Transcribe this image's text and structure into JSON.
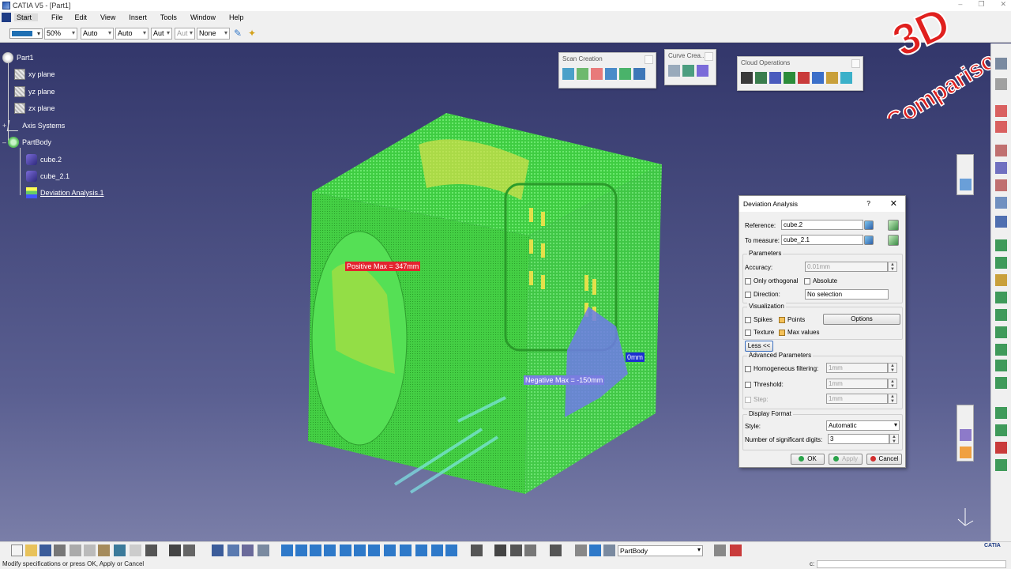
{
  "window": {
    "title": "CATIA V5 - [Part1]"
  },
  "menu": [
    "Start",
    "File",
    "Edit",
    "View",
    "Insert",
    "Tools",
    "Window",
    "Help"
  ],
  "graphic_properties": {
    "color": "#1f6fb3",
    "transparency": "50%",
    "line_thickness": "Auto",
    "line_type": "Auto",
    "point_type": "Aut",
    "point_type2": "Aut",
    "layer": "None"
  },
  "tree": {
    "root": "Part1",
    "items": [
      {
        "label": "xy plane"
      },
      {
        "label": "yz plane"
      },
      {
        "label": "zx plane"
      },
      {
        "label": "Axis Systems"
      },
      {
        "label": "PartBody"
      },
      {
        "label": "cube.2"
      },
      {
        "label": "cube_2.1"
      },
      {
        "label": "Deviation Analysis.1"
      }
    ]
  },
  "toolbars": {
    "scan_creation": "Scan Creation",
    "curve_creation": "Curve Crea...",
    "cloud_operations": "Cloud Operations"
  },
  "labels": {
    "positive_max": "Positive Max = 347mm",
    "negative_max": "Negative Max = -150mm",
    "zero": "0mm"
  },
  "watermark": {
    "line1": "3D",
    "line2": "Comparison"
  },
  "dialog": {
    "title": "Deviation Analysis",
    "help": "?",
    "close": "✕",
    "reference_label": "Reference:",
    "reference_value": "cube.2",
    "to_measure_label": "To measure:",
    "to_measure_value": "cube_2.1",
    "parameters_label": "Parameters",
    "accuracy_label": "Accuracy:",
    "accuracy_value": "0.01mm",
    "only_orthogonal": "Only orthogonal",
    "absolute": "Absolute",
    "direction_label": "Direction:",
    "direction_value": "No selection",
    "visualization_label": "Visualization",
    "spikes": "Spikes",
    "points": "Points",
    "options_button": "Options",
    "texture": "Texture",
    "max_values": "Max values",
    "less_button": "Less <<",
    "advanced_label": "Advanced Parameters",
    "homogeneous_label": "Homogeneous filtering:",
    "homogeneous_value": "1mm",
    "threshold_label": "Threshold:",
    "threshold_value": "1mm",
    "step_label": "Step:",
    "step_value": "1mm",
    "display_format_label": "Display Format",
    "style_label": "Style:",
    "style_value": "Automatic",
    "sig_digits_label": "Number of significant digits:",
    "sig_digits_value": "3",
    "ok": "OK",
    "apply": "Apply",
    "cancel": "Cancel"
  },
  "bottom": {
    "current_body": "PartBody"
  },
  "status": {
    "message": "Modify specifications or press OK, Apply or Cancel",
    "cmd_label": "c:"
  },
  "corner_logo": "CATIA"
}
